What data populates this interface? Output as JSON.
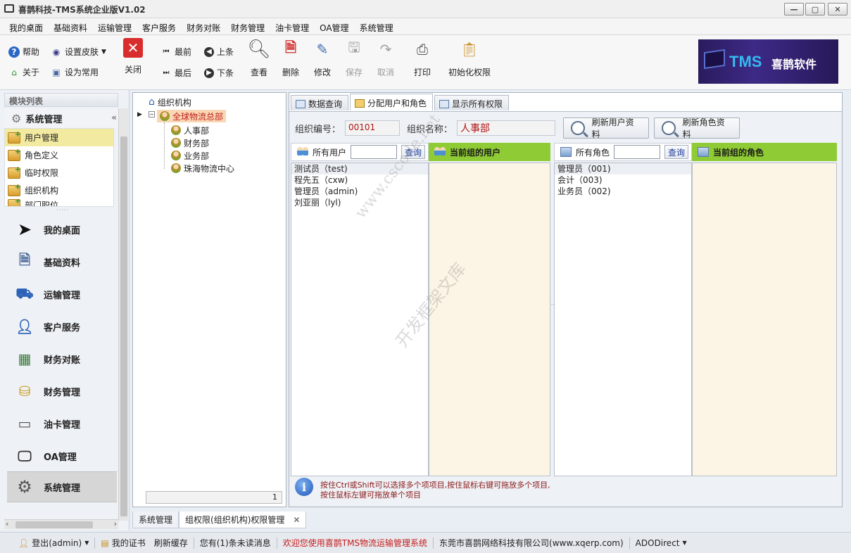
{
  "window": {
    "title": "喜鹊科技-TMS系统企业版V1.02"
  },
  "menu": [
    "我的桌面",
    "基础资料",
    "运输管理",
    "客户服务",
    "财务对账",
    "财务管理",
    "油卡管理",
    "OA管理",
    "系统管理"
  ],
  "toolbar": {
    "help": "帮助",
    "skin": "设置皮肤",
    "about": "关于",
    "favorite": "设为常用",
    "close": "关闭",
    "first": "最前",
    "last": "最后",
    "prev": "上条",
    "next": "下条",
    "view": "查看",
    "delete": "删除",
    "edit": "修改",
    "save": "保存",
    "cancel": "取消",
    "print": "打印",
    "init_perm": "初始化权限"
  },
  "brand": {
    "tms": "TMS",
    "name": "喜鹊软件"
  },
  "sidebar": {
    "header": "模块列表",
    "group": "系统管理",
    "items": [
      {
        "label": "用户管理",
        "active": true
      },
      {
        "label": "角色定义",
        "active": false
      },
      {
        "label": "临时权限",
        "active": false
      },
      {
        "label": "组织机构",
        "active": false
      },
      {
        "label": "部门职位",
        "active": false
      }
    ],
    "nav": [
      "我的桌面",
      "基础资料",
      "运输管理",
      "客户服务",
      "财务对账",
      "财务管理",
      "油卡管理",
      "OA管理",
      "系统管理"
    ]
  },
  "tree": {
    "root": "组织机构",
    "selected": "全球物流总部",
    "children": [
      "人事部",
      "财务部",
      "业务部",
      "珠海物流中心"
    ],
    "status": "1"
  },
  "tabs": [
    "数据查询",
    "分配用户和角色",
    "显示所有权限"
  ],
  "org": {
    "code_label": "组织编号：",
    "code": "00101",
    "name_label": "组织名称：",
    "name": "人事部"
  },
  "buttons": {
    "refresh_users": "刷新用户资料",
    "refresh_roles": "刷新角色资料",
    "query": "查询"
  },
  "users": {
    "all_label": "所有用户",
    "current_label": "当前组的用户",
    "list": [
      "测试员（test)",
      "程先五（cxw)",
      "管理员（admin)",
      "刘亚丽（lyl)"
    ]
  },
  "roles": {
    "all_label": "所有角色",
    "current_label": "当前组的角色",
    "list": [
      "管理员（001)",
      "会计（003)",
      "业务员（002)"
    ]
  },
  "info": "按住Ctrl或Shift可以选择多个项项目,按住鼠标右键可拖放多个项目,按住鼠标左键可拖放单个项目",
  "watermark": {
    "line1": "www.cscode.net",
    "line2": "开发框架文库"
  },
  "doc_tabs": [
    "系统管理",
    "组权限(组织机构)权限管理"
  ],
  "status": {
    "user": "登出(admin)",
    "cert": "我的证书",
    "refresh": "刷新缓存",
    "msg": "您有(1)条未读消息",
    "welcome": "欢迎您使用喜鹊TMS物流运输管理系统",
    "company": "东莞市喜鹊网络科技有限公司(www.xqerp.com)",
    "db": "ADODirect"
  }
}
